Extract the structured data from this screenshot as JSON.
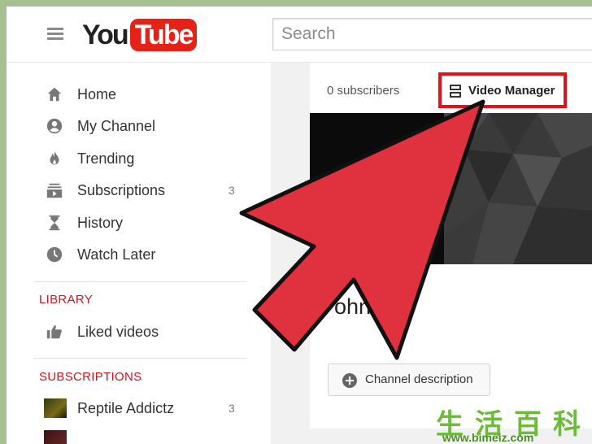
{
  "header": {
    "logo_you": "You",
    "logo_tube": "Tube",
    "search_placeholder": "Search"
  },
  "sidebar": {
    "items": [
      {
        "label": "Home",
        "icon": "home-icon"
      },
      {
        "label": "My Channel",
        "icon": "account-icon"
      },
      {
        "label": "Trending",
        "icon": "flame-icon"
      },
      {
        "label": "Subscriptions",
        "icon": "subscriptions-icon",
        "count": "3"
      },
      {
        "label": "History",
        "icon": "hourglass-icon"
      },
      {
        "label": "Watch Later",
        "icon": "clock-icon"
      }
    ],
    "library_heading": "LIBRARY",
    "library_items": [
      {
        "label": "Liked videos",
        "icon": "thumbs-up-icon"
      }
    ],
    "subscriptions_heading": "SUBSCRIPTIONS",
    "subscription_items": [
      {
        "label": "Reptile Addictz",
        "count": "3"
      }
    ]
  },
  "channel": {
    "subscribers": "0 subscribers",
    "video_manager": "Video Manager",
    "name_partial": "ohn    th",
    "description_button": "Channel description"
  },
  "watermark": {
    "chinese": "生活百科",
    "url": "www.bimeiz.com"
  },
  "colors": {
    "brand_red": "#e62117",
    "highlight_box": "#e3131b",
    "arrow_fill": "#e0313f",
    "section_heading": "#cc181e",
    "page_border": "#a7c08f"
  }
}
